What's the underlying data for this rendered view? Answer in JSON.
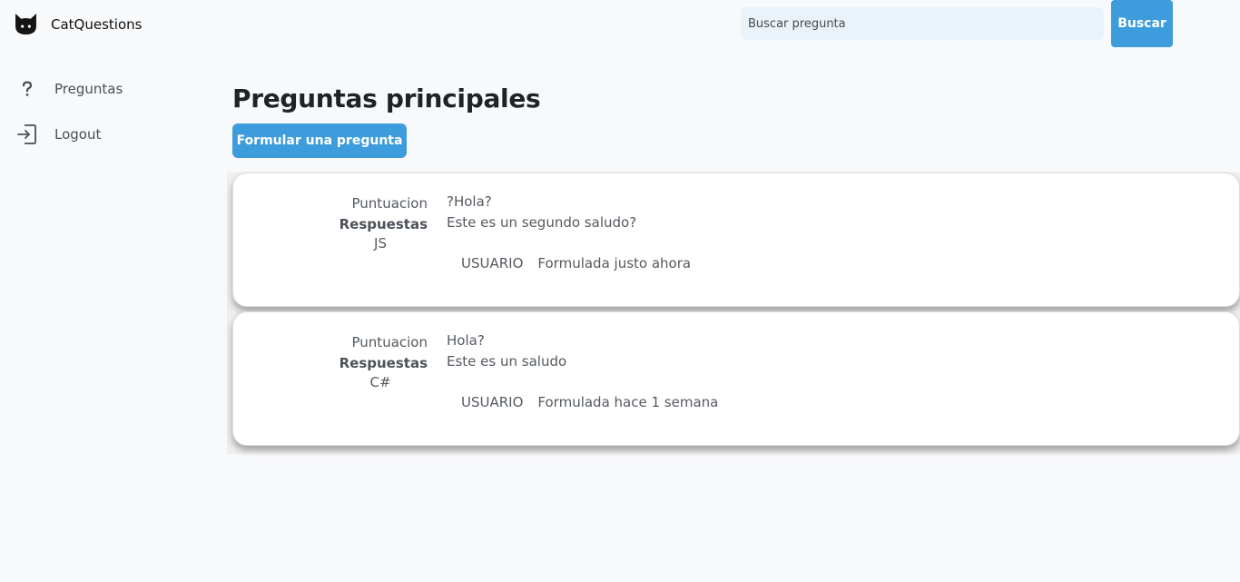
{
  "app": {
    "name": "CatQuestions"
  },
  "search": {
    "placeholder": "Buscar pregunta",
    "button_label": "Buscar"
  },
  "sidebar": {
    "items": [
      {
        "label": "Preguntas",
        "icon": "question-mark-icon"
      },
      {
        "label": "Logout",
        "icon": "logout-icon"
      }
    ]
  },
  "main": {
    "title": "Preguntas principales",
    "ask_button_label": "Formular una pregunta",
    "questions": [
      {
        "score_label": "Puntuacion",
        "answers_label": "Respuestas",
        "tag": "JS",
        "title": "?Hola?",
        "body": "Este es un segundo saludo?",
        "user": "USUARIO",
        "asked": "Formulada justo ahora"
      },
      {
        "score_label": "Puntuacion",
        "answers_label": "Respuestas",
        "tag": "C#",
        "title": "Hola?",
        "body": "Este es un saludo",
        "user": "USUARIO",
        "asked": "Formulada hace 1 semana"
      }
    ]
  },
  "colors": {
    "accent": "#3d9cdb",
    "background": "#f8f9fb",
    "search_bg": "#eaf2fa"
  }
}
